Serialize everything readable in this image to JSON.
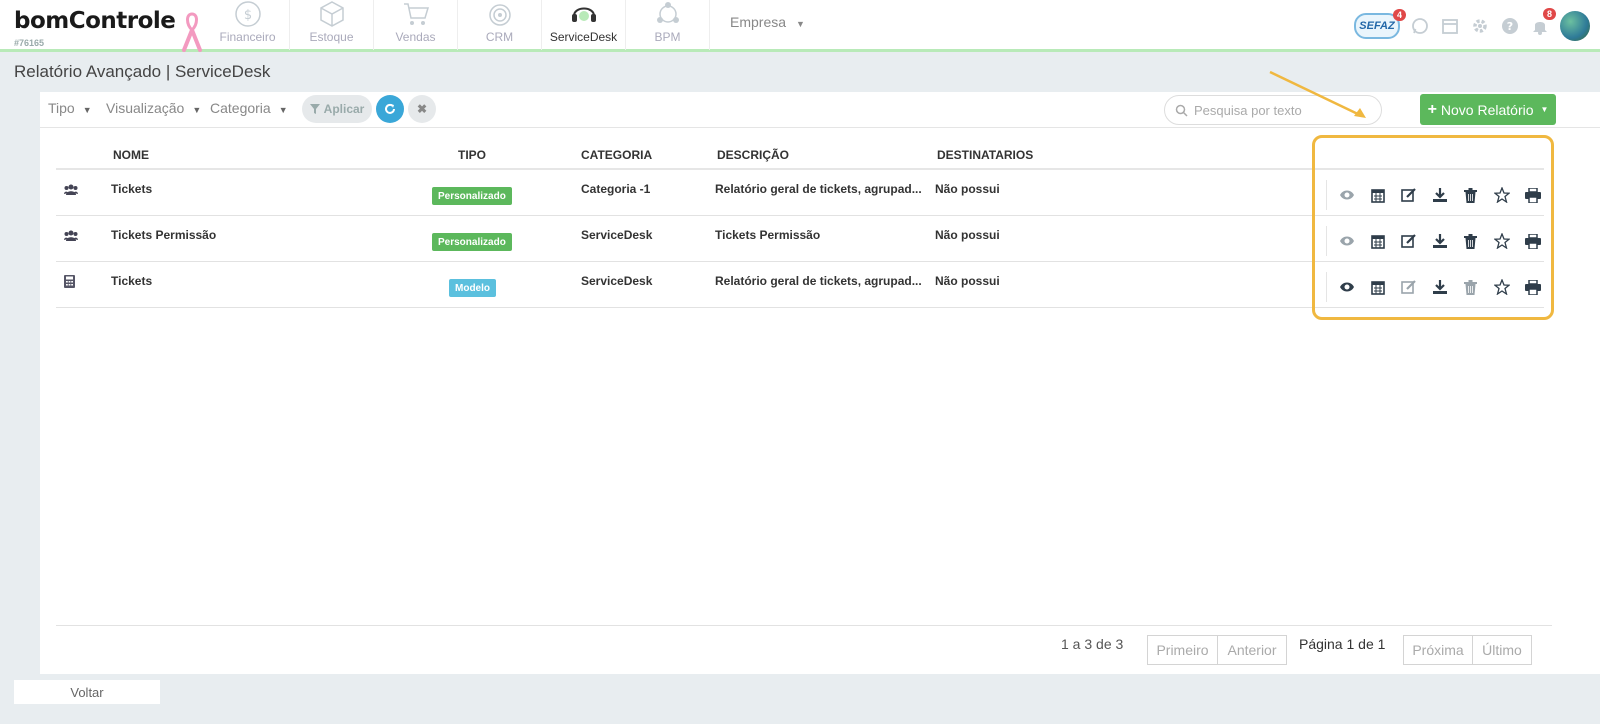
{
  "app": {
    "brand": "bomControle",
    "account_id": "#76165",
    "modules": [
      {
        "label": "Financeiro",
        "icon": "dollar-icon",
        "active": false
      },
      {
        "label": "Estoque",
        "icon": "box-icon",
        "active": false
      },
      {
        "label": "Vendas",
        "icon": "cart-icon",
        "active": false
      },
      {
        "label": "CRM",
        "icon": "target-icon",
        "active": false
      },
      {
        "label": "ServiceDesk",
        "icon": "headset-icon",
        "active": true
      },
      {
        "label": "BPM",
        "icon": "network-icon",
        "active": false
      }
    ],
    "company_menu": "Empresa",
    "sefaz": {
      "label": "SEFAZ",
      "count": "4"
    },
    "notifications_count": "8"
  },
  "page": {
    "title": "Relatório Avançado | ServiceDesk"
  },
  "filters": {
    "tipo": "Tipo",
    "visualizacao": "Visualização",
    "categoria": "Categoria",
    "apply": "Aplicar",
    "search_placeholder": "Pesquisa por texto",
    "new_report": "Novo Relatório"
  },
  "table": {
    "headers": {
      "nome": "NOME",
      "tipo": "TIPO",
      "categoria": "CATEGORIA",
      "descricao": "DESCRIÇÃO",
      "destinatarios": "DESTINATARIOS"
    },
    "rows": [
      {
        "icon": "users-icon",
        "nome": "Tickets",
        "tipo": "Personalizado",
        "tipo_color": "#5cb85c",
        "categoria": "Categoria -1",
        "descricao": "Relatório geral de tickets, agrupad...",
        "destinatarios": "Não possui"
      },
      {
        "icon": "users-icon",
        "nome": "Tickets Permissão",
        "tipo": "Personalizado",
        "tipo_color": "#5cb85c",
        "categoria": "ServiceDesk",
        "descricao": "Tickets Permissão",
        "destinatarios": "Não possui"
      },
      {
        "icon": "calculator-icon",
        "nome": "Tickets",
        "tipo": "Modelo",
        "tipo_color": "#5bc0de",
        "categoria": "ServiceDesk",
        "descricao": "Relatório geral de tickets, agrupad...",
        "destinatarios": "Não possui"
      }
    ]
  },
  "pagination": {
    "range": "1 a 3 de 3",
    "first": "Primeiro",
    "prev": "Anterior",
    "page_info": "Página 1 de 1",
    "next": "Próxima",
    "last": "Último"
  },
  "footer": {
    "back": "Voltar"
  },
  "colors": {
    "accent_green": "#5cb85c",
    "accent_blue": "#3aa7d8",
    "highlight": "#f0b840"
  }
}
